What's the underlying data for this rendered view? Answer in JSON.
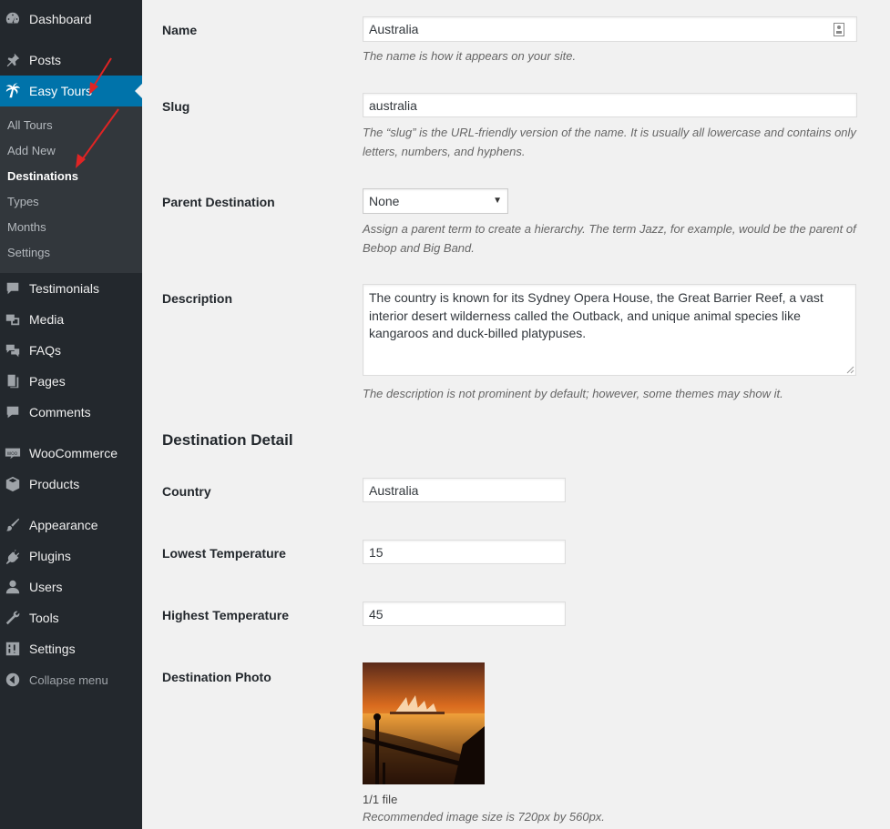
{
  "sidebar": {
    "items": [
      {
        "label": "Dashboard",
        "icon": "dashboard-icon"
      },
      {
        "label": "Posts",
        "icon": "pin-icon"
      },
      {
        "label": "Easy Tours",
        "icon": "palm-tree-icon"
      },
      {
        "label": "Testimonials",
        "icon": "comment-icon"
      },
      {
        "label": "Media",
        "icon": "media-icon"
      },
      {
        "label": "FAQs",
        "icon": "faq-icon"
      },
      {
        "label": "Pages",
        "icon": "pages-icon"
      },
      {
        "label": "Comments",
        "icon": "comments-icon"
      },
      {
        "label": "WooCommerce",
        "icon": "woocommerce-icon"
      },
      {
        "label": "Products",
        "icon": "box-icon"
      },
      {
        "label": "Appearance",
        "icon": "brush-icon"
      },
      {
        "label": "Plugins",
        "icon": "plug-icon"
      },
      {
        "label": "Users",
        "icon": "user-icon"
      },
      {
        "label": "Tools",
        "icon": "wrench-icon"
      },
      {
        "label": "Settings",
        "icon": "settings-icon"
      }
    ],
    "submenu": [
      "All Tours",
      "Add New",
      "Destinations",
      "Types",
      "Months",
      "Settings"
    ],
    "collapse_label": "Collapse menu"
  },
  "form": {
    "name_label": "Name",
    "name_value": "Australia",
    "name_desc": "The name is how it appears on your site.",
    "slug_label": "Slug",
    "slug_value": "australia",
    "slug_desc_1": "The “slug” is the URL-friendly version of the name. It is usually all lowercase and contains only",
    "slug_desc_2": "letters, numbers, and hyphens.",
    "parent_label": "Parent Destination",
    "parent_value": "None",
    "parent_desc_1": "Assign a parent term to create a hierarchy. The term Jazz, for example, would be the parent of",
    "parent_desc_2": "Bebop and Big Band.",
    "description_label": "Description",
    "description_value": "The country is known for its Sydney Opera House, the Great Barrier Reef, a vast interior desert wilderness called the Outback, and unique animal species like kangaroos and duck-billed platypuses.",
    "description_desc": "The description is not prominent by default; however, some themes may show it."
  },
  "detail": {
    "title": "Destination Detail",
    "country_label": "Country",
    "country_value": "Australia",
    "lowest_label": "Lowest Temperature",
    "lowest_value": "15",
    "highest_label": "Highest Temperature",
    "highest_value": "45",
    "photo_label": "Destination Photo",
    "file_count": "1/1 file",
    "photo_hint": "Recommended image size is 720px by 560px."
  },
  "colors": {
    "sidebar_bg": "#23282d",
    "submenu_bg": "#32373c",
    "accent": "#0073aa",
    "arrow": "#e02424"
  }
}
